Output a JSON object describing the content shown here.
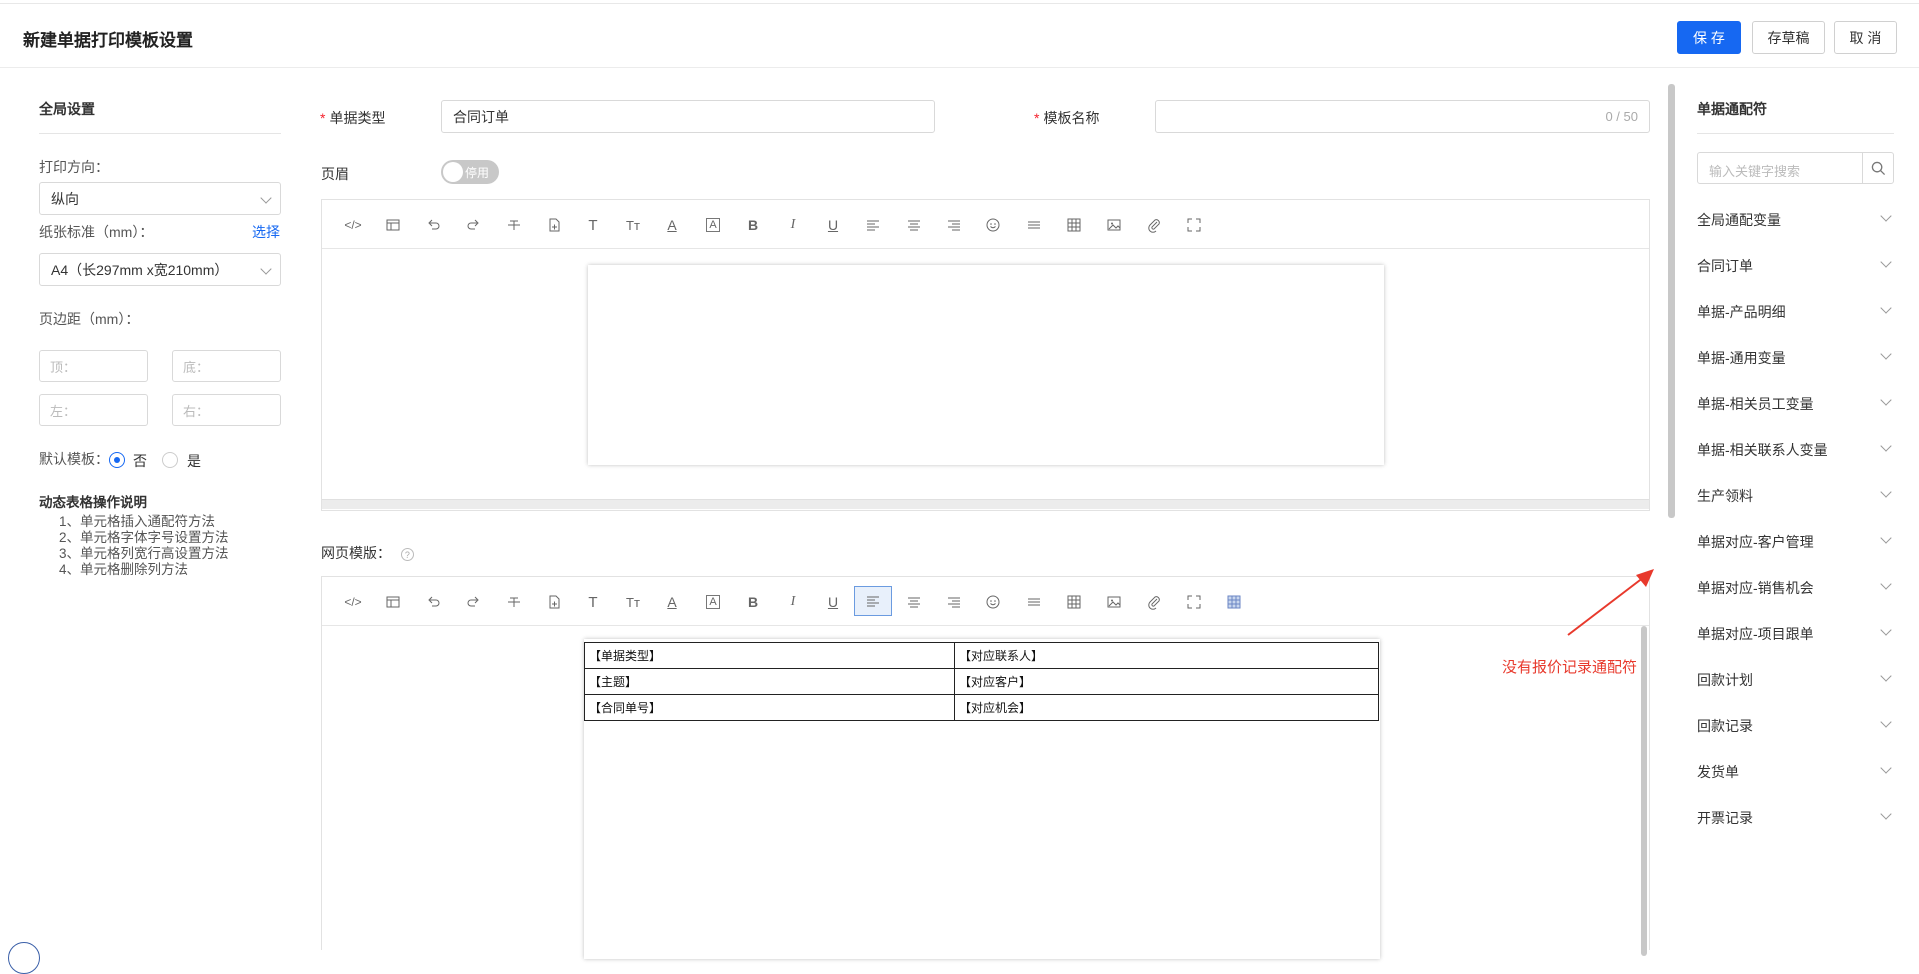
{
  "header": {
    "title": "新建单据打印模板设置",
    "save_label": "保 存",
    "draft_label": "存草稿",
    "cancel_label": "取 消",
    "accent_color": "#1668f2"
  },
  "global_settings": {
    "title": "全局设置",
    "orientation_label": "打印方向：",
    "orientation_value": "纵向",
    "paper_label": "纸张标准（mm）：",
    "paper_select_link": "选择",
    "paper_value": "A4（长297mm x宽210mm）",
    "margin_label": "页边距（mm）：",
    "margin_top_placeholder": "顶：",
    "margin_bottom_placeholder": "底：",
    "margin_left_placeholder": "左：",
    "margin_right_placeholder": "右：",
    "default_template_label": "默认模板：",
    "default_no": "否",
    "default_yes": "是",
    "default_selected": "否",
    "help_title": "动态表格操作说明",
    "help_items": [
      "1、单元格插入通配符方法",
      "2、单元格字体字号设置方法",
      "3、单元格列宽行高设置方法",
      "4、单元格删除列方法"
    ]
  },
  "form": {
    "doc_type_label": "单据类型",
    "doc_type_value": "合同订单",
    "template_name_label": "模板名称",
    "template_name_value": "",
    "template_name_counter": "0 / 50",
    "header_label": "页眉",
    "header_toggle_label": "停用",
    "web_template_label": "网页模版：",
    "help_icon_glyph": "?"
  },
  "toolbar_icons": [
    "code-icon",
    "template-icon",
    "undo-icon",
    "redo-icon",
    "strikethrough-icon",
    "insert-doc-icon",
    "font-icon",
    "font-size-icon",
    "font-color-icon",
    "background-color-icon",
    "bold-icon",
    "italic-icon",
    "underline-icon",
    "align-left-icon",
    "align-center-icon",
    "align-right-icon",
    "emoji-icon",
    "line-height-icon",
    "table-icon",
    "image-icon",
    "attachment-icon",
    "fullscreen-icon"
  ],
  "toolbar_glyphs": {
    "code-icon": "</>",
    "font-icon": "T",
    "font-size-icon": "Tт",
    "font-color-icon": "A",
    "background-color-icon": "A",
    "bold-icon": "B",
    "italic-icon": "I",
    "underline-icon": "U"
  },
  "content_table": [
    [
      "【单据类型】",
      "【对应联系人】"
    ],
    [
      "【主题】",
      "【对应客户】"
    ],
    [
      "【合同单号】",
      "【对应机会】"
    ]
  ],
  "wildcards": {
    "title": "单据通配符",
    "search_placeholder": "输入关键字搜索",
    "groups": [
      "全局通配变量",
      "合同订单",
      "单据-产品明细",
      "单据-通用变量",
      "单据-相关员工变量",
      "单据-相关联系人变量",
      "生产领料",
      "单据对应-客户管理",
      "单据对应-销售机会",
      "单据对应-项目跟单",
      "回款计划",
      "回款记录",
      "发货单",
      "开票记录"
    ]
  },
  "annotation": {
    "text": "没有报价记录通配符",
    "color": "#e8392c"
  }
}
